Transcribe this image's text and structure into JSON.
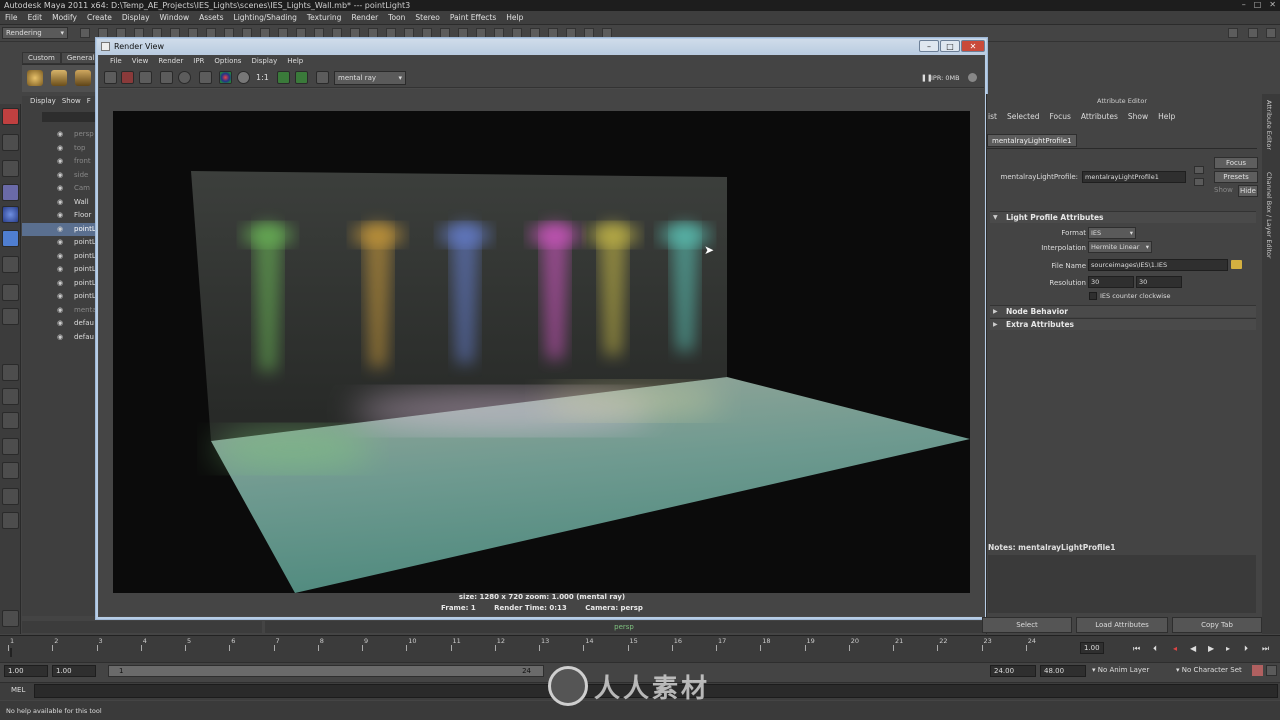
{
  "app_title": "Autodesk Maya 2011 x64: D:\\Temp_AE_Projects\\IES_Lights\\scenes\\IES_Lights_Wall.mb*  ---  pointLight3",
  "menu": [
    "File",
    "Edit",
    "Modify",
    "Create",
    "Display",
    "Window",
    "Assets",
    "Lighting/Shading",
    "Texturing",
    "Render",
    "Toon",
    "Stereo",
    "Paint Effects",
    "Help"
  ],
  "mode": "Rendering",
  "shelf_tabs": [
    "Custom",
    "General"
  ],
  "outliner": {
    "menu": [
      "Display",
      "Show",
      "F"
    ],
    "items": [
      {
        "label": "persp",
        "state": "dim"
      },
      {
        "label": "top",
        "state": "dim"
      },
      {
        "label": "front",
        "state": "dim"
      },
      {
        "label": "side",
        "state": "dim"
      },
      {
        "label": "Cam",
        "state": "dim"
      },
      {
        "label": "Wall",
        "state": "normal"
      },
      {
        "label": "Floor",
        "state": "normal"
      },
      {
        "label": "pointL",
        "state": "selected"
      },
      {
        "label": "pointL",
        "state": "normal"
      },
      {
        "label": "pointL",
        "state": "normal"
      },
      {
        "label": "pointL",
        "state": "normal"
      },
      {
        "label": "pointL",
        "state": "normal"
      },
      {
        "label": "pointL",
        "state": "normal"
      },
      {
        "label": "mental",
        "state": "dim"
      },
      {
        "label": "defau",
        "state": "normal"
      },
      {
        "label": "defau",
        "state": "normal"
      }
    ]
  },
  "render_view": {
    "title": "Render View",
    "menu": [
      "File",
      "View",
      "Render",
      "IPR",
      "Options",
      "Display",
      "Help"
    ],
    "ratio_label": "1:1",
    "renderer": "mental ray",
    "ipr_status": "IPR: 0MB",
    "info_line1": "size: 1280 x 720 zoom: 1.000       (mental ray)",
    "frame": "Frame: 1",
    "render_time": "Render Time: 0:13",
    "camera": "Camera: persp",
    "window_controls": [
      "–",
      "□",
      "✕"
    ],
    "light_colors": [
      "#6fc25a",
      "#d9a43a",
      "#6a86e0",
      "#e05ad0",
      "#d4c54a",
      "#5fd0c2"
    ]
  },
  "viewport_label": "persp",
  "attribute_editor": {
    "title": "Attribute Editor",
    "menu": [
      "ist",
      "Selected",
      "Focus",
      "Attributes",
      "Show",
      "Help"
    ],
    "tab": "mentalrayLightProfile1",
    "node_label": "mentalrayLightProfile:",
    "node_value": "mentalrayLightProfile1",
    "focus_btn": "Focus",
    "presets_btn": "Presets",
    "show_btn": "Show",
    "hide_btn": "Hide",
    "section_light": "Light Profile Attributes",
    "format_label": "Format",
    "format_value": "IES",
    "interp_label": "Interpolation",
    "interp_value": "Hermite Linear",
    "file_label": "File Name",
    "file_value": "sourceimages\\IES\\1.IES",
    "res_label": "Resolution",
    "res_a": "30",
    "res_b": "30",
    "ies_ccw": "IES counter clockwise",
    "section_node": "Node Behavior",
    "section_extra": "Extra Attributes",
    "notes": "Notes:  mentalrayLightProfile1",
    "select_btn": "Select",
    "load_btn": "Load Attributes",
    "copy_btn": "Copy Tab",
    "side_tabs": [
      "Attribute Editor",
      "Channel Box / Layer Editor"
    ]
  },
  "timeline": {
    "ticks": [
      "1",
      "2",
      "3",
      "4",
      "5",
      "6",
      "7",
      "8",
      "9",
      "10",
      "11",
      "12",
      "13",
      "14",
      "15",
      "16",
      "17",
      "18",
      "19",
      "20",
      "21",
      "22",
      "23",
      "24"
    ],
    "current": "1.00"
  },
  "range": {
    "start": "1.00",
    "start2": "1.00",
    "range_min": "1",
    "range_max": "24",
    "end": "24.00",
    "end2": "48.00",
    "anim_layer": "No Anim Layer",
    "char_set": "No Character Set"
  },
  "mel_label": "MEL",
  "help_text": "No help available for this tool",
  "watermark": "人人素材"
}
